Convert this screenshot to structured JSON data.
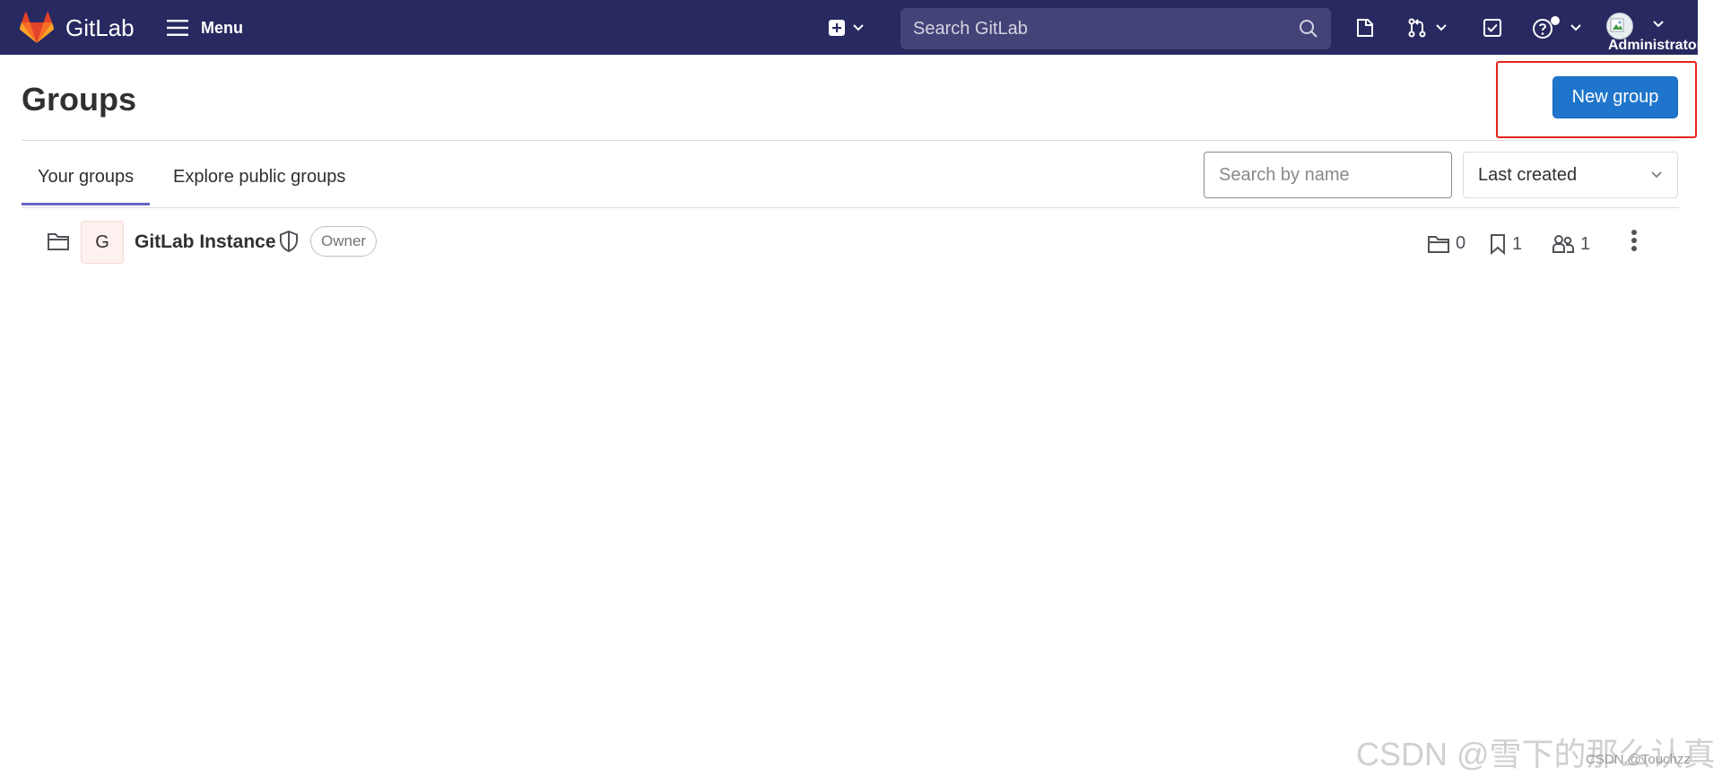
{
  "navbar": {
    "brand": "GitLab",
    "menu_label": "Menu",
    "search_placeholder": "Search GitLab",
    "user_name": "Administrator"
  },
  "header": {
    "title": "Groups",
    "new_group_label": "New group"
  },
  "tabs": [
    {
      "label": "Your groups",
      "active": true
    },
    {
      "label": "Explore public groups",
      "active": false
    }
  ],
  "filters": {
    "search_placeholder": "Search by name",
    "sort_selected": "Last created"
  },
  "groups": [
    {
      "avatar_letter": "G",
      "name": "GitLab Instance",
      "role": "Owner",
      "subgroups": "0",
      "projects": "1",
      "members": "1"
    }
  ],
  "watermark": {
    "main": "CSDN @雪下的那么认真",
    "small": "CSDN @Touchzz"
  },
  "colors": {
    "navbar": "#292961",
    "primary_button": "#1f75cb",
    "active_tab": "#6666c4",
    "highlight": "#e8231c"
  }
}
